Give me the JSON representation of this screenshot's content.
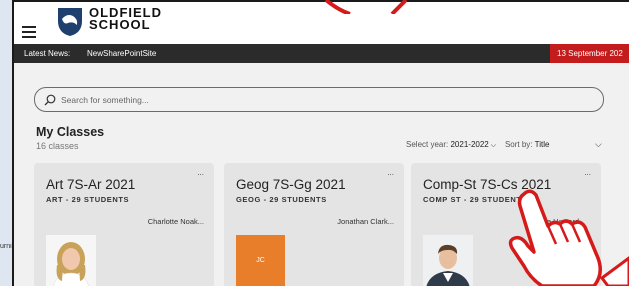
{
  "background": {
    "left_text": "urni"
  },
  "header": {
    "school_name_line1": "OLDFIELD",
    "school_name_line2": "SCHOOL",
    "brand_color": "#1f3f6e"
  },
  "newsbar": {
    "label": "Latest News:",
    "link": "NewSharePointSite",
    "date": "13 September 202",
    "date_color": "#c41c1c"
  },
  "search": {
    "placeholder": "Search for something..."
  },
  "classes": {
    "title": "My Classes",
    "count": "16 classes",
    "year_label": "Select year:",
    "year_value": "2021-2022",
    "sort_label": "Sort by:",
    "sort_value": "Title",
    "cards": [
      {
        "title": "Art 7S-Ar 2021",
        "subtitle": "ART - 29 STUDENTS",
        "teacher": "Charlotte Noak...",
        "menu": "..."
      },
      {
        "title": "Geog 7S-Gg 2021",
        "subtitle": "GEOG - 29 STUDENTS",
        "teacher": "Jonathan Clark...",
        "initials": "JC",
        "menu": "..."
      },
      {
        "title": "Comp-St 7S-Cs 2021",
        "subtitle": "COMP ST - 29 STUDENTS",
        "teacher": "Luke Howard",
        "menu": "..."
      }
    ]
  },
  "icons": [
    "hamburger-menu-icon",
    "school-crest-icon",
    "search-icon",
    "chevron-down-icon",
    "pointing-hand-icon"
  ]
}
